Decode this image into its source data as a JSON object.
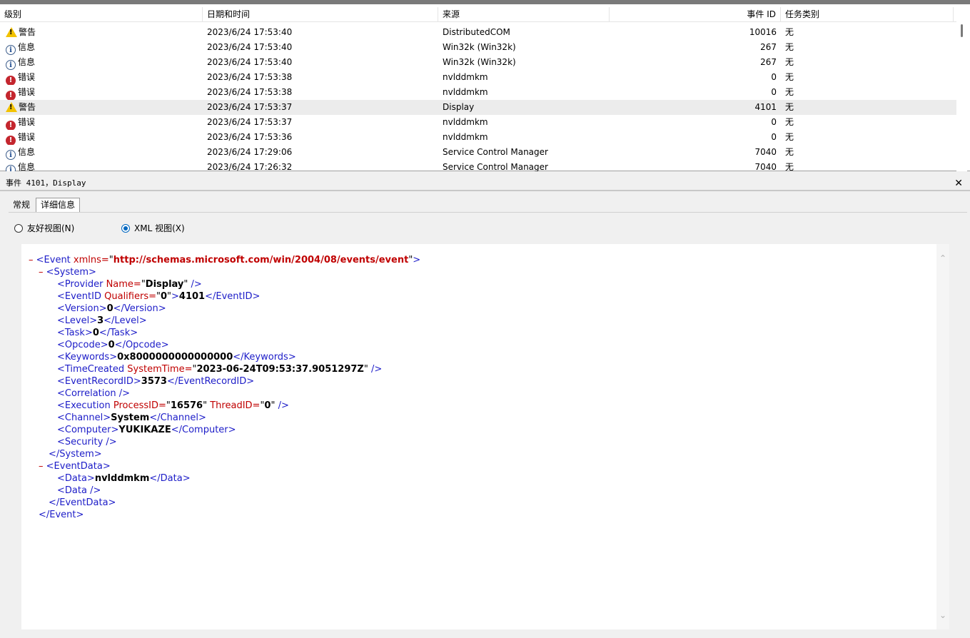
{
  "list": {
    "columns": {
      "level": "级别",
      "datetime": "日期和时间",
      "source": "来源",
      "event_id": "事件 ID",
      "task": "任务类别"
    },
    "rows": [
      {
        "type": "warn",
        "level": "警告",
        "datetime": "2023/6/24 17:53:40",
        "source": "DistributedCOM",
        "event_id": "10016",
        "task": "无"
      },
      {
        "type": "info",
        "level": "信息",
        "datetime": "2023/6/24 17:53:40",
        "source": "Win32k (Win32k)",
        "event_id": "267",
        "task": "无"
      },
      {
        "type": "info",
        "level": "信息",
        "datetime": "2023/6/24 17:53:40",
        "source": "Win32k (Win32k)",
        "event_id": "267",
        "task": "无"
      },
      {
        "type": "err",
        "level": "错误",
        "datetime": "2023/6/24 17:53:38",
        "source": "nvlddmkm",
        "event_id": "0",
        "task": "无"
      },
      {
        "type": "err",
        "level": "错误",
        "datetime": "2023/6/24 17:53:38",
        "source": "nvlddmkm",
        "event_id": "0",
        "task": "无"
      },
      {
        "type": "warn",
        "level": "警告",
        "datetime": "2023/6/24 17:53:37",
        "source": "Display",
        "event_id": "4101",
        "task": "无",
        "selected": true
      },
      {
        "type": "err",
        "level": "错误",
        "datetime": "2023/6/24 17:53:37",
        "source": "nvlddmkm",
        "event_id": "0",
        "task": "无"
      },
      {
        "type": "err",
        "level": "错误",
        "datetime": "2023/6/24 17:53:36",
        "source": "nvlddmkm",
        "event_id": "0",
        "task": "无"
      },
      {
        "type": "info",
        "level": "信息",
        "datetime": "2023/6/24 17:29:06",
        "source": "Service Control Manager",
        "event_id": "7040",
        "task": "无"
      },
      {
        "type": "info",
        "level": "信息",
        "datetime": "2023/6/24 17:26:32",
        "source": "Service Control Manager",
        "event_id": "7040",
        "task": "无"
      }
    ]
  },
  "details": {
    "title": "事件 4101，Display",
    "close_glyph": "✕",
    "tabs": [
      "常规",
      "详细信息"
    ],
    "view_friendly": "友好视图(N)",
    "view_xml": "XML 视图(X)"
  },
  "xml": {
    "minus": "–",
    "event_open": "<Event",
    "xmlns_attr": "xmlns=",
    "xmlns_val": "http://schemas.microsoft.com/win/2004/08/events/event",
    "system_open": "<System>",
    "provider_tag": "<Provider",
    "provider_attr": "Name=",
    "provider_val": "Display",
    "eventid_tag": "<EventID",
    "eventid_attr": "Qualifiers=",
    "eventid_attr_val": "0",
    "eventid_val": "4101",
    "eventid_close": "</EventID>",
    "version_open": "<Version>",
    "version_val": "0",
    "version_close": "</Version>",
    "level_open": "<Level>",
    "level_val": "3",
    "level_close": "</Level>",
    "task_open": "<Task>",
    "task_val": "0",
    "task_close": "</Task>",
    "opcode_open": "<Opcode>",
    "opcode_val": "0",
    "opcode_close": "</Opcode>",
    "keywords_open": "<Keywords>",
    "keywords_val": "0x8000000000000000",
    "keywords_close": "</Keywords>",
    "timecreated_tag": "<TimeCreated",
    "timecreated_attr": "SystemTime=",
    "timecreated_val": "2023-06-24T09:53:37.9051297Z",
    "recordid_open": "<EventRecordID>",
    "recordid_val": "3573",
    "recordid_close": "</EventRecordID>",
    "correlation": "<Correlation />",
    "execution_tag": "<Execution",
    "execution_pid_attr": "ProcessID=",
    "execution_pid_val": "16576",
    "execution_tid_attr": "ThreadID=",
    "execution_tid_val": "0",
    "channel_open": "<Channel>",
    "channel_val": "System",
    "channel_close": "</Channel>",
    "computer_open": "<Computer>",
    "computer_val": "YUKIKAZE",
    "computer_close": "</Computer>",
    "security": "<Security />",
    "system_close": "</System>",
    "eventdata_open": "<EventData>",
    "data_open": "<Data>",
    "data_val": "nvlddmkm",
    "data_close": "</Data>",
    "data_empty": "<Data />",
    "eventdata_close": "</EventData>",
    "event_close": "</Event>",
    "self_close": " />",
    "gt": ">",
    "quote": "\""
  },
  "colors": {
    "tag": "#1c1cc8",
    "attr": "#c00000",
    "warn": "#f2c200",
    "error": "#c4262e",
    "info": "#1f4c8f",
    "radio_on": "#0067c0"
  }
}
